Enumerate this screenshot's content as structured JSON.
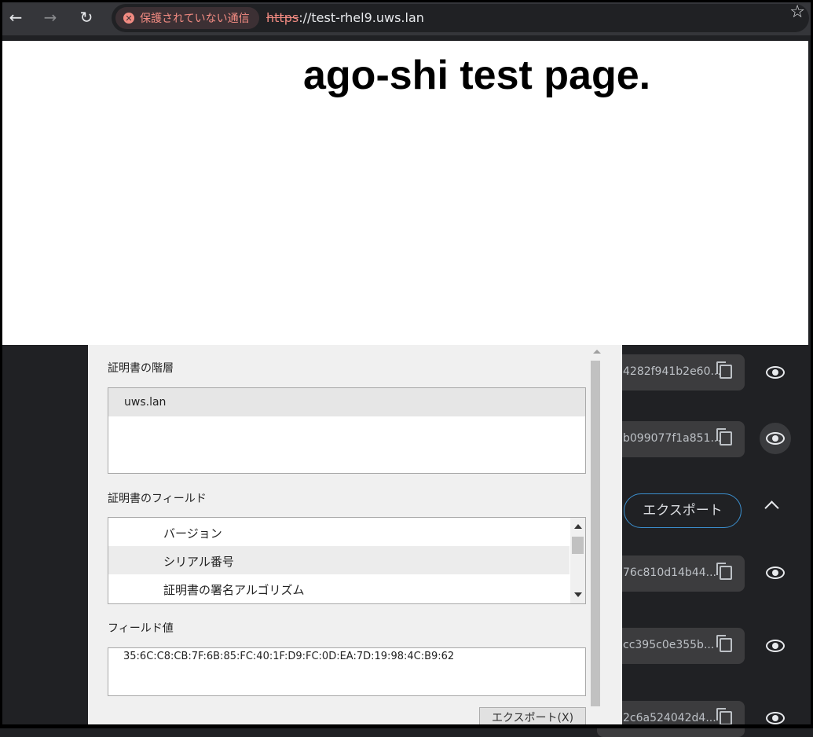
{
  "browser": {
    "security_label": "保護されていない通信",
    "url_scheme": "https",
    "url_rest": "://test-rhel9.uws.lan"
  },
  "page": {
    "title": "ago-shi test page."
  },
  "settings": {
    "keys": [
      "4282f941b2e60...",
      "b099077f1a851...",
      "76c810d14b44...",
      "cc395c0e355b...",
      "2c6a524042d4..."
    ],
    "export_label": "エクスポート"
  },
  "dialog": {
    "hierarchy_label": "証明書の階層",
    "hierarchy_items": [
      "uws.lan"
    ],
    "fields_label": "証明書のフィールド",
    "fields": [
      "バージョン",
      "シリアル番号",
      "証明書の署名アルゴリズム"
    ],
    "selected_field_index": 1,
    "value_label": "フィールド値",
    "field_value": "35:6C:C8:CB:7F:6B:85:FC:40:1F:D9:FC:0D:EA:7D:19:98:4C:B9:62",
    "export_button": "エクスポート(X)"
  }
}
